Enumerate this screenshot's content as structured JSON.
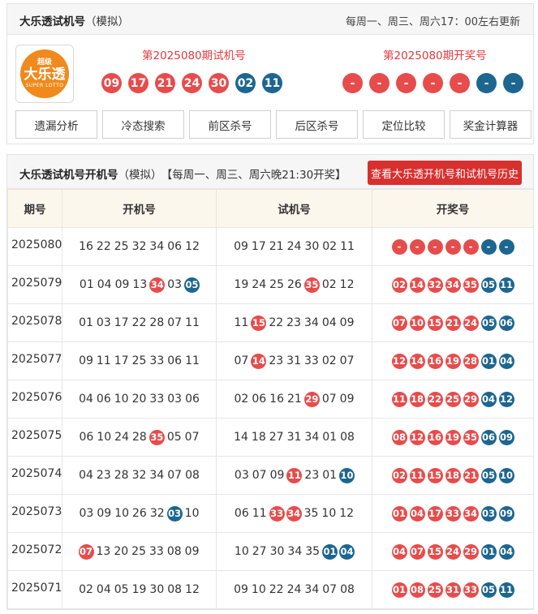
{
  "top": {
    "title": "大乐透试机号",
    "title_sub": "（模拟）",
    "update_note": "每周一、周三、周六17：00左右更新",
    "logo": {
      "top": "超级",
      "main": "大乐透",
      "bottom": "SUPER LOTTO"
    },
    "trial_caption": "第2025080期试机号",
    "draw_caption": "第2025080期开奖号",
    "trial_balls": [
      {
        "n": "09",
        "c": "red"
      },
      {
        "n": "17",
        "c": "red"
      },
      {
        "n": "21",
        "c": "red"
      },
      {
        "n": "24",
        "c": "red"
      },
      {
        "n": "30",
        "c": "red"
      },
      {
        "n": "02",
        "c": "blue"
      },
      {
        "n": "11",
        "c": "blue"
      }
    ],
    "draw_balls": [
      {
        "n": "-",
        "c": "red"
      },
      {
        "n": "-",
        "c": "red"
      },
      {
        "n": "-",
        "c": "red"
      },
      {
        "n": "-",
        "c": "red"
      },
      {
        "n": "-",
        "c": "red"
      },
      {
        "n": "-",
        "c": "blue"
      },
      {
        "n": "-",
        "c": "blue"
      }
    ],
    "tools": [
      "遗漏分析",
      "冷态搜索",
      "前区杀号",
      "后区杀号",
      "定位比较",
      "奖金计算器"
    ]
  },
  "table": {
    "title": "大乐透试机号开机号",
    "title_sub": "（模拟）",
    "schedule": "【每周一、周三、周六晚21:30开奖】",
    "history_button": "查看大乐透开机号和试机号历史",
    "headers": [
      "期号",
      "开机号",
      "试机号",
      "开奖号"
    ],
    "rows": [
      {
        "issue": "2025080",
        "open": [
          "16",
          "22",
          "25",
          "32",
          "34",
          "06",
          "12"
        ],
        "open_hl": [],
        "trial": [
          "09",
          "17",
          "21",
          "24",
          "30",
          "02",
          "11"
        ],
        "trial_hl": [],
        "draw": [
          "-",
          "-",
          "-",
          "-",
          "-",
          "-",
          "-"
        ]
      },
      {
        "issue": "2025079",
        "open": [
          "01",
          "04",
          "09",
          "13",
          "34",
          "03",
          "05"
        ],
        "open_hl": [
          4,
          6
        ],
        "trial": [
          "19",
          "24",
          "25",
          "26",
          "35",
          "02",
          "12"
        ],
        "trial_hl": [
          4
        ],
        "draw": [
          "02",
          "14",
          "32",
          "34",
          "35",
          "05",
          "11"
        ]
      },
      {
        "issue": "2025078",
        "open": [
          "01",
          "03",
          "17",
          "22",
          "28",
          "07",
          "11"
        ],
        "open_hl": [],
        "trial": [
          "11",
          "15",
          "22",
          "23",
          "34",
          "04",
          "09"
        ],
        "trial_hl": [
          1
        ],
        "draw": [
          "07",
          "10",
          "15",
          "21",
          "24",
          "05",
          "06"
        ]
      },
      {
        "issue": "2025077",
        "open": [
          "09",
          "11",
          "17",
          "25",
          "33",
          "06",
          "11"
        ],
        "open_hl": [],
        "trial": [
          "07",
          "14",
          "23",
          "31",
          "33",
          "02",
          "07"
        ],
        "trial_hl": [
          1
        ],
        "draw": [
          "12",
          "14",
          "16",
          "19",
          "28",
          "01",
          "04"
        ]
      },
      {
        "issue": "2025076",
        "open": [
          "04",
          "06",
          "10",
          "20",
          "33",
          "03",
          "06"
        ],
        "open_hl": [],
        "trial": [
          "02",
          "06",
          "16",
          "21",
          "29",
          "07",
          "09"
        ],
        "trial_hl": [
          4
        ],
        "draw": [
          "11",
          "18",
          "22",
          "25",
          "29",
          "04",
          "12"
        ]
      },
      {
        "issue": "2025075",
        "open": [
          "06",
          "10",
          "24",
          "28",
          "35",
          "05",
          "07"
        ],
        "open_hl": [
          4
        ],
        "trial": [
          "14",
          "18",
          "27",
          "31",
          "34",
          "01",
          "08"
        ],
        "trial_hl": [],
        "draw": [
          "08",
          "12",
          "16",
          "19",
          "35",
          "06",
          "09"
        ]
      },
      {
        "issue": "2025074",
        "open": [
          "04",
          "23",
          "28",
          "32",
          "34",
          "07",
          "08"
        ],
        "open_hl": [],
        "trial": [
          "03",
          "07",
          "09",
          "11",
          "23",
          "01",
          "10"
        ],
        "trial_hl": [
          3,
          6
        ],
        "draw": [
          "02",
          "11",
          "15",
          "18",
          "21",
          "05",
          "10"
        ]
      },
      {
        "issue": "2025073",
        "open": [
          "03",
          "09",
          "10",
          "26",
          "32",
          "03",
          "10"
        ],
        "open_hl": [
          5
        ],
        "trial": [
          "06",
          "11",
          "33",
          "34",
          "35",
          "10",
          "12"
        ],
        "trial_hl": [
          2,
          3
        ],
        "draw": [
          "01",
          "04",
          "17",
          "33",
          "34",
          "03",
          "09"
        ]
      },
      {
        "issue": "2025072",
        "open": [
          "07",
          "13",
          "20",
          "25",
          "33",
          "08",
          "09"
        ],
        "open_hl": [
          0
        ],
        "trial": [
          "10",
          "27",
          "30",
          "34",
          "35",
          "01",
          "04"
        ],
        "trial_hl": [
          5,
          6
        ],
        "draw": [
          "04",
          "07",
          "15",
          "24",
          "29",
          "01",
          "04"
        ]
      },
      {
        "issue": "2025071",
        "open": [
          "02",
          "04",
          "05",
          "19",
          "30",
          "08",
          "12"
        ],
        "open_hl": [],
        "trial": [
          "09",
          "10",
          "22",
          "24",
          "34",
          "07",
          "08"
        ],
        "trial_hl": [],
        "draw": [
          "01",
          "08",
          "25",
          "31",
          "33",
          "05",
          "11"
        ]
      }
    ]
  },
  "colors": {
    "red": "#e74c4c",
    "blue": "#1d6690",
    "accent": "#d7302f",
    "header_bg": "#fcf7ec"
  }
}
